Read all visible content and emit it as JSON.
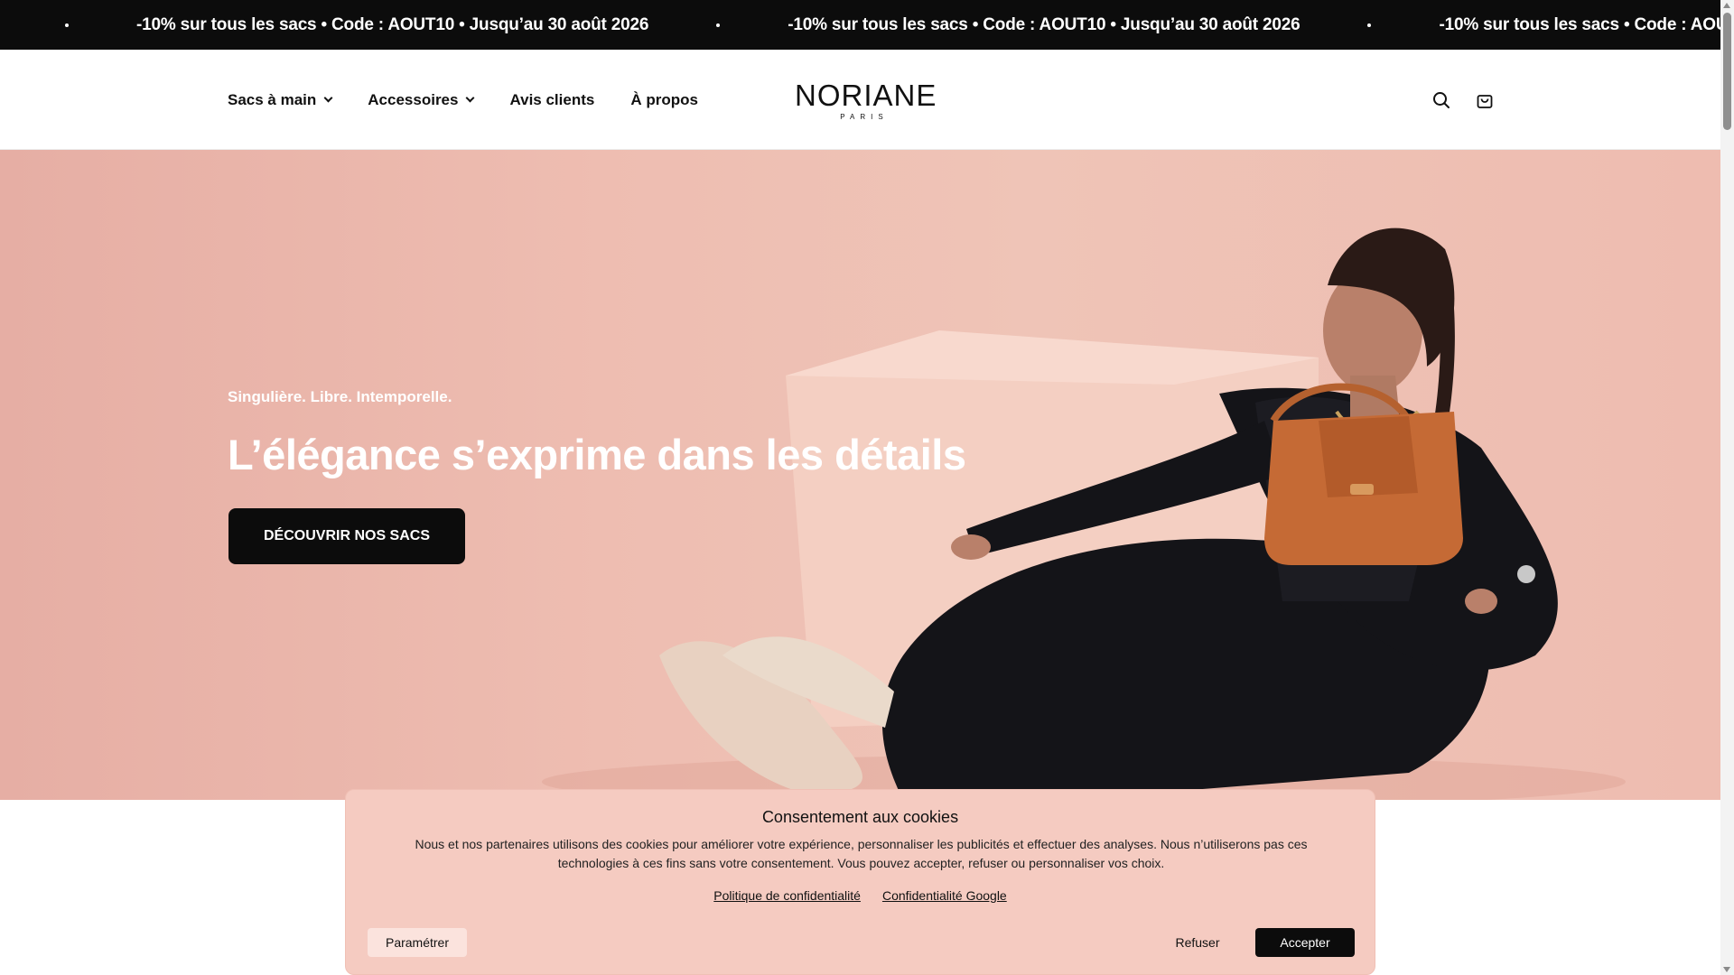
{
  "announcement": {
    "items": [
      "-10% sur tous les sacs • Code : AOUT10 • Jusqu’au 30 août 2026",
      "-10% sur tous les sacs • Code : AOUT10 • Jusqu’au 30 août 2026",
      "-10% sur tous les sacs • Code : AOUT10 • Jusqu’au 30 août 2026"
    ]
  },
  "header": {
    "nav": [
      {
        "label": "Sacs à main",
        "has_dropdown": true
      },
      {
        "label": "Accessoires",
        "has_dropdown": true
      },
      {
        "label": "Avis clients",
        "has_dropdown": false
      },
      {
        "label": "À propos",
        "has_dropdown": false
      }
    ],
    "logo": {
      "name": "NORIANE",
      "sub": "PARIS"
    },
    "icons": [
      "search-icon",
      "shopping-bag-icon"
    ]
  },
  "hero": {
    "eyebrow": "Singulière. Libre. Intemporelle.",
    "title": "L’élégance s’exprime dans les détails",
    "cta": "DÉCOUVRIR NOS SACS",
    "background_color": "#eebdb1"
  },
  "cookie": {
    "title": "Consentement aux cookies",
    "text": "Nous et nos partenaires utilisons des cookies pour améliorer votre expérience, personnaliser les publicités et effectuer des analyses. Nous n’utiliserons pas ces technologies à ces fins sans votre consentement. Vous pouvez accepter, refuser ou personnaliser vos choix.",
    "links": [
      "Politique de confidentialité",
      "Confidentialité Google"
    ],
    "settings_label": "Paramétrer",
    "refuse_label": "Refuser",
    "accept_label": "Accepter",
    "background_color": "#f5cbc1"
  },
  "colors": {
    "accent": "#0c0c0c",
    "announcement_bg": "#0c0c0c"
  }
}
